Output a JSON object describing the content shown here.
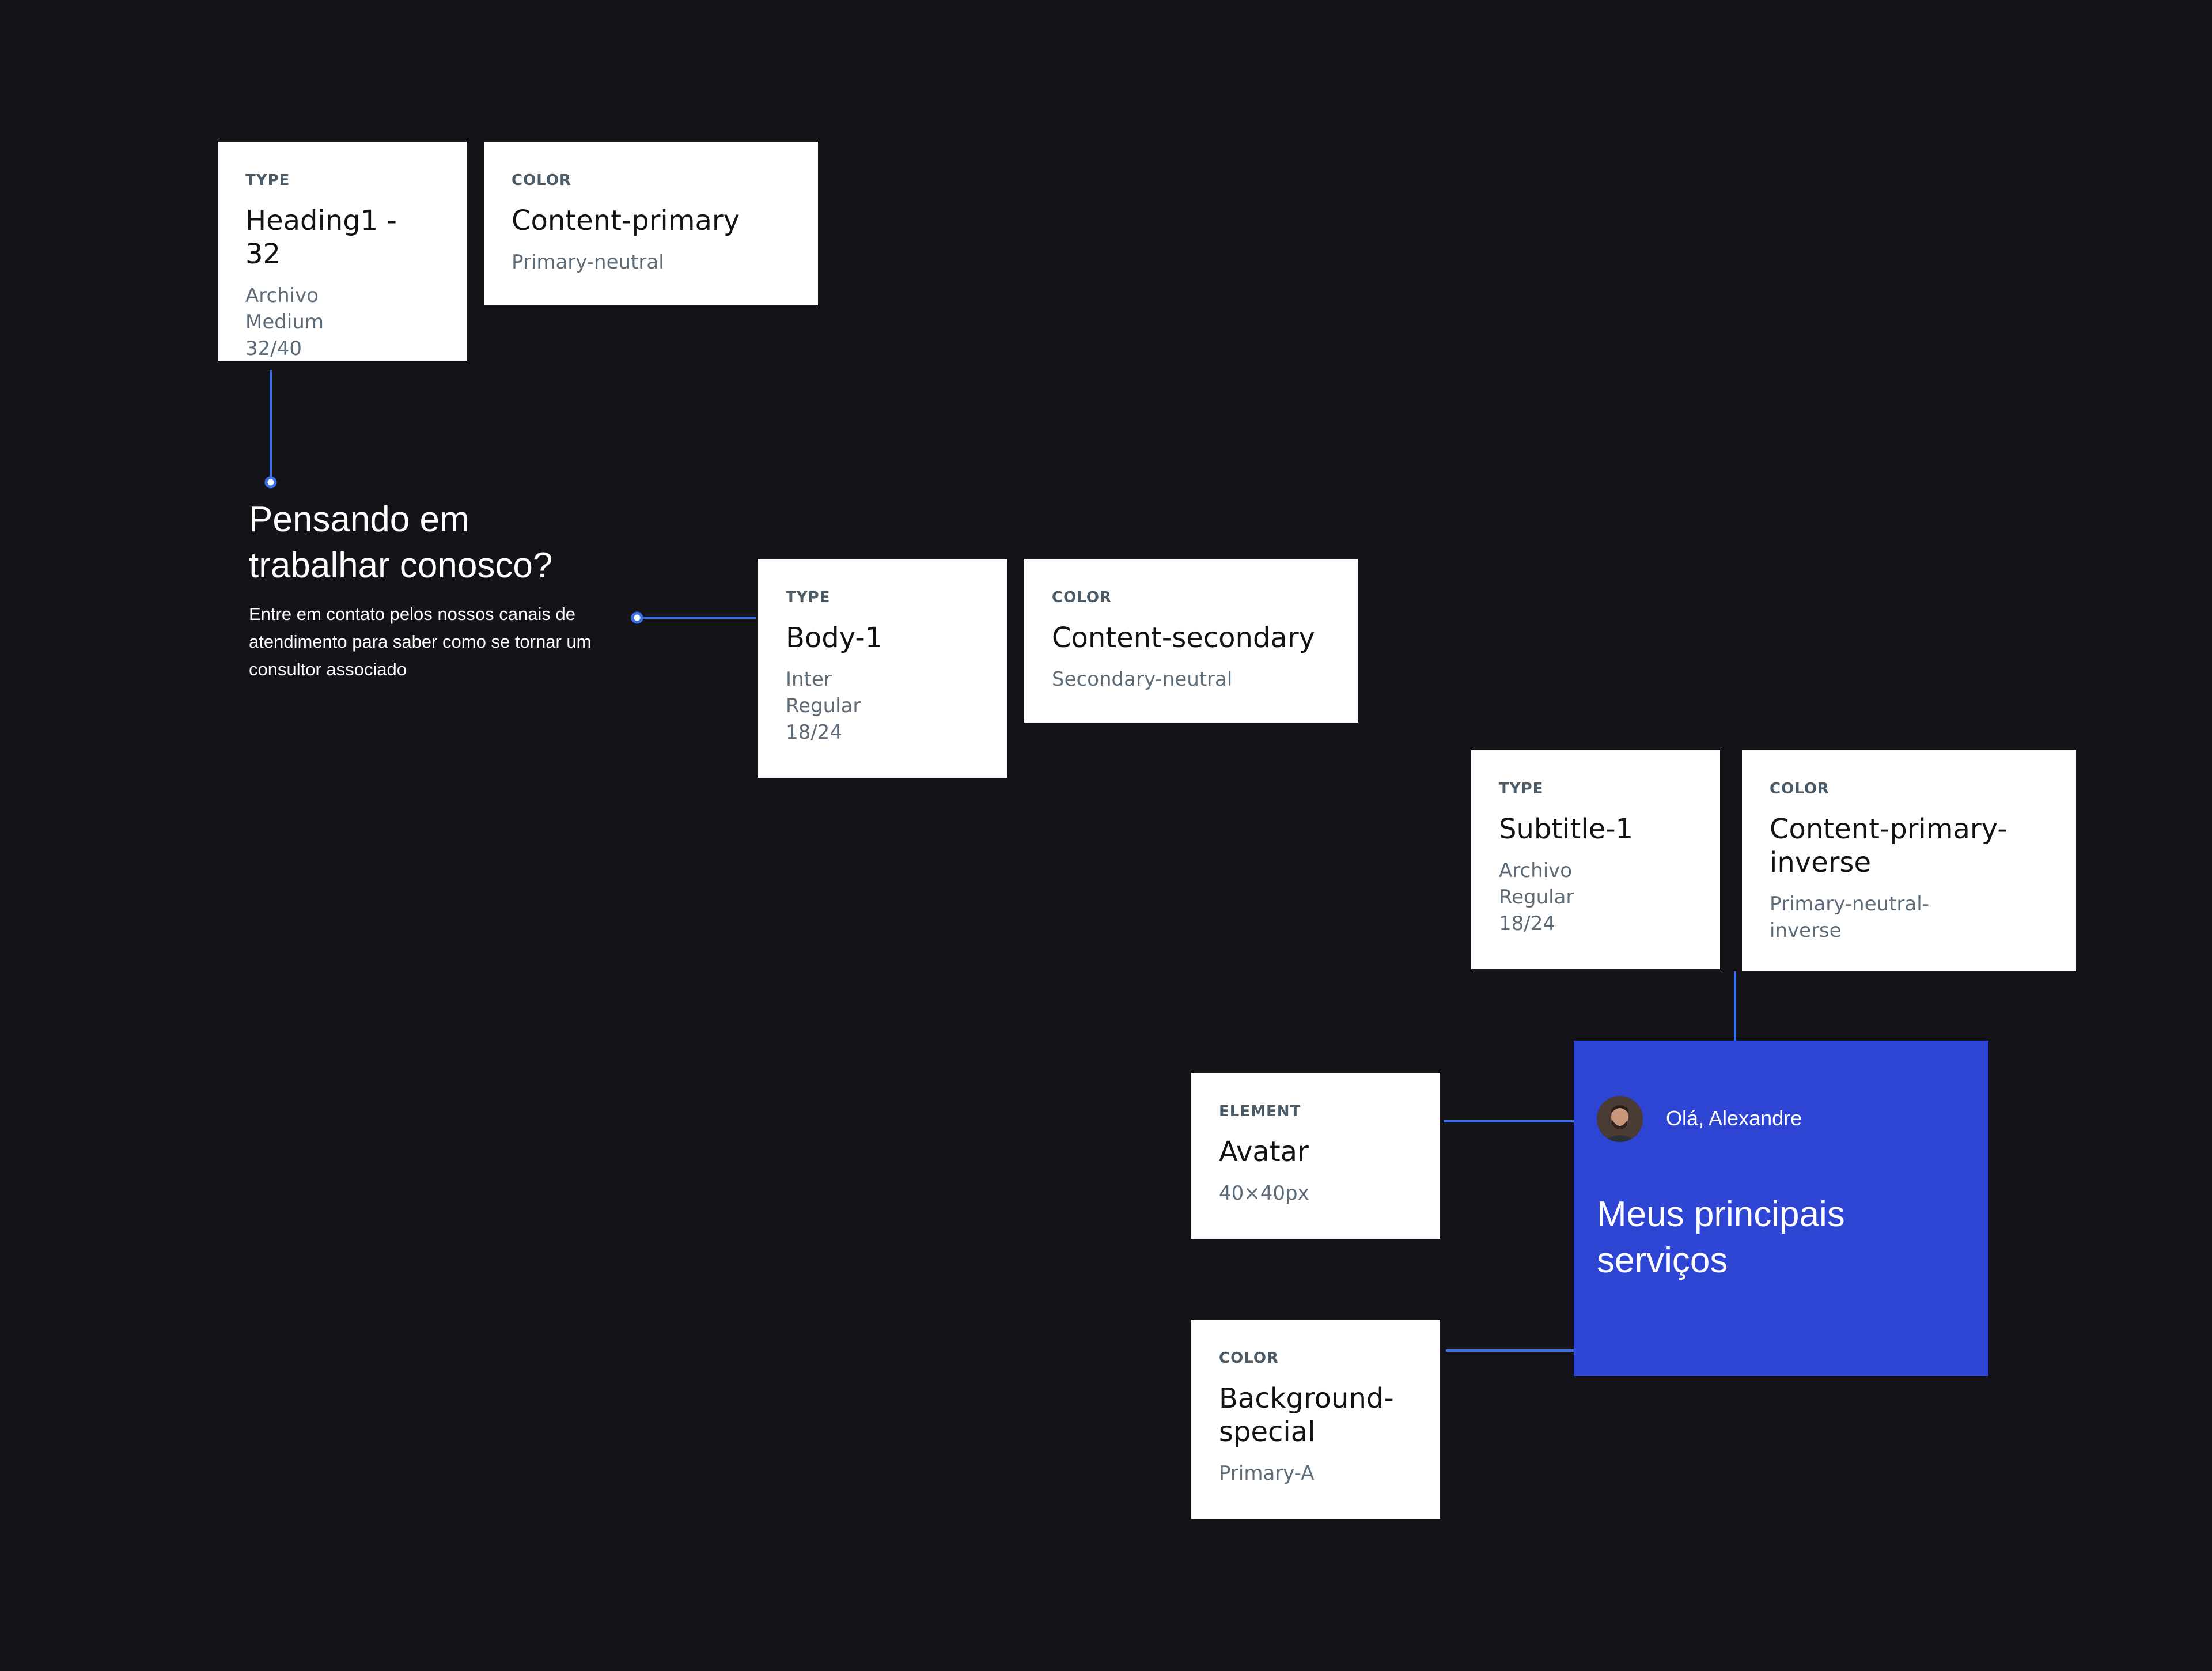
{
  "cards": {
    "heading_type": {
      "category": "TYPE",
      "name": "Heading1 - 32",
      "details": [
        "Archivo",
        "Medium",
        "32/40"
      ]
    },
    "heading_color": {
      "category": "COLOR",
      "name": "Content-primary",
      "details": [
        "Primary-neutral"
      ]
    },
    "body_type": {
      "category": "TYPE",
      "name": "Body-1",
      "details": [
        "Inter",
        "Regular",
        "18/24"
      ]
    },
    "body_color": {
      "category": "COLOR",
      "name": "Content-secondary",
      "details": [
        "Secondary-neutral"
      ]
    },
    "subtitle_type": {
      "category": "TYPE",
      "name": "Subtitle-1",
      "details": [
        "Archivo",
        "Regular",
        "18/24"
      ]
    },
    "subtitle_color": {
      "category": "COLOR",
      "name": [
        "Content-primary-",
        "inverse"
      ],
      "details": [
        "Primary-neutral-",
        "inverse"
      ]
    },
    "avatar_element": {
      "category": "ELEMENT",
      "name": "Avatar",
      "details": [
        "40×40px"
      ]
    },
    "bg_color": {
      "category": "COLOR",
      "name": [
        "Background-",
        "special"
      ],
      "details": [
        "Primary-A"
      ]
    }
  },
  "sample": {
    "heading": "Pensando em trabalhar conosco?",
    "body": "Entre em contato pelos nossos canais de atendimento para saber como se tornar um consultor associado"
  },
  "panel": {
    "greeting": "Olá, Alexandre",
    "title": "Meus principais serviços",
    "background_color": "#2e45d4"
  },
  "colors": {
    "background": "#131318",
    "connector": "#3b6fe8",
    "card": "#ffffff"
  }
}
